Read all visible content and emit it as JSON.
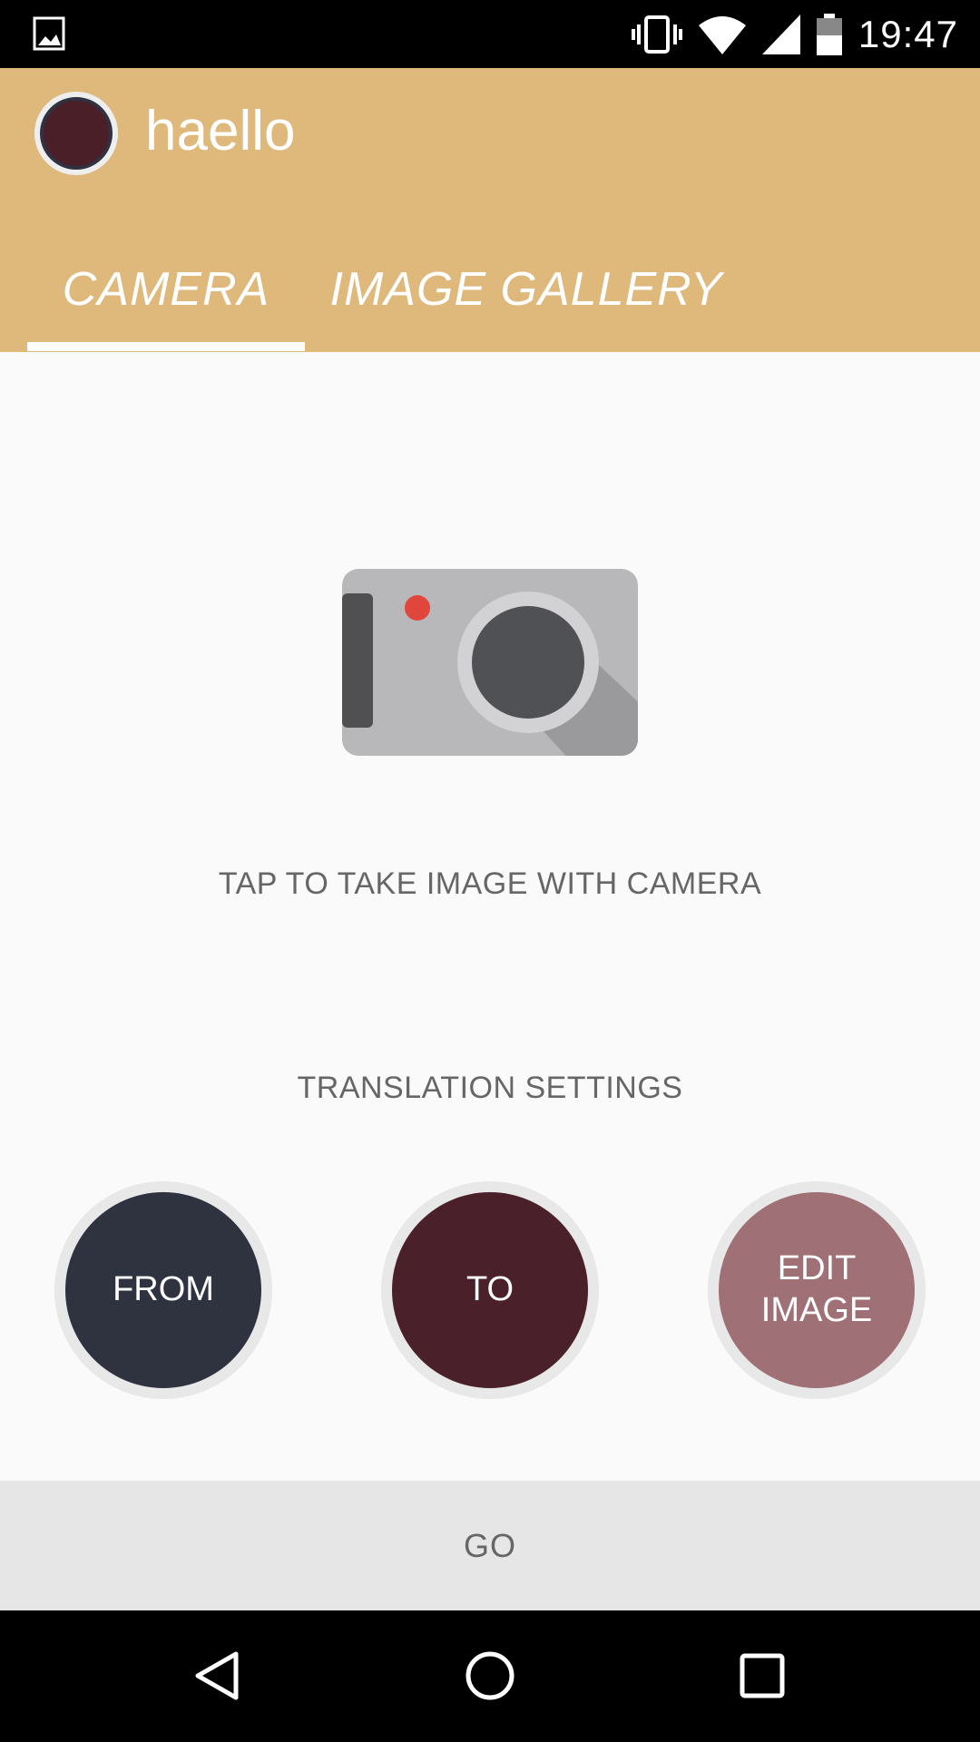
{
  "status_bar": {
    "time": "19:47",
    "icons": [
      "gallery-notification-icon",
      "vibrate-icon",
      "wifi-icon",
      "signal-icon",
      "battery-icon"
    ]
  },
  "app_bar": {
    "title": "haello",
    "background_color": "#dfb87c"
  },
  "tabs": [
    {
      "label": "CAMERA",
      "selected": true
    },
    {
      "label": "IMAGE GALLERY",
      "selected": false
    }
  ],
  "main": {
    "camera_icon": "camera-icon",
    "camera_hint": "TAP TO TAKE IMAGE WITH CAMERA",
    "settings_title": "TRANSLATION SETTINGS",
    "buttons": {
      "from_label": "FROM",
      "to_label": "TO",
      "edit_label": "EDIT IMAGE"
    },
    "button_colors": {
      "from": "#2f3340",
      "to": "#4a212b",
      "edit": "#a07077"
    }
  },
  "footer": {
    "go_label": "GO"
  },
  "nav_bar": {
    "icons": [
      "back-icon",
      "home-icon",
      "recents-icon"
    ]
  }
}
